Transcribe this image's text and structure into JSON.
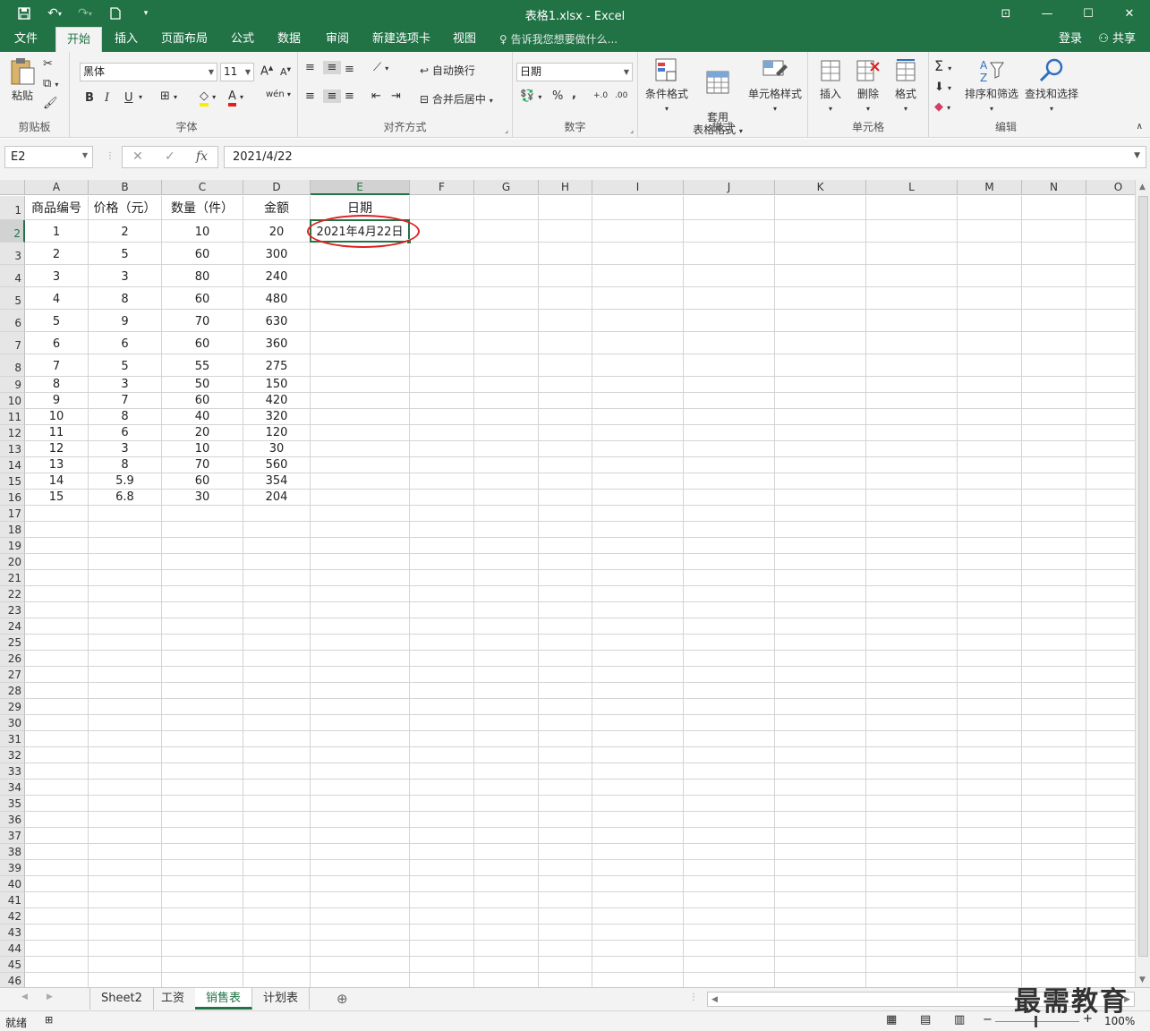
{
  "app": {
    "title": "表格1.xlsx - Excel",
    "login": "登录",
    "share": "共享",
    "tell_me": "告诉我您想要做什么..."
  },
  "tabs": [
    "文件",
    "开始",
    "插入",
    "页面布局",
    "公式",
    "数据",
    "审阅",
    "新建选项卡",
    "视图"
  ],
  "ribbon": {
    "clipboard": {
      "paste": "粘贴",
      "label": "剪贴板"
    },
    "font": {
      "name": "黑体",
      "size": "11",
      "label": "字体",
      "bold": "B",
      "italic": "I",
      "underline": "U"
    },
    "alignment": {
      "wrap": "自动换行",
      "merge": "合并后居中",
      "label": "对齐方式"
    },
    "number": {
      "format": "日期",
      "percent": "%",
      "comma": ",",
      "label": "数字"
    },
    "styles": {
      "cond": "条件格式",
      "table": "套用\n表格格式",
      "cell": "单元格样式",
      "label": "样式"
    },
    "cells": {
      "insert": "插入",
      "delete": "删除",
      "format": "格式",
      "label": "单元格"
    },
    "editing": {
      "sort": "排序和筛选",
      "find": "查找和选择",
      "label": "编辑"
    }
  },
  "formula_bar": {
    "name_box": "E2",
    "fx": "fx",
    "value": "2021/4/22"
  },
  "columns": [
    "A",
    "B",
    "C",
    "D",
    "E",
    "F",
    "G",
    "H",
    "I",
    "J",
    "K",
    "L",
    "M",
    "N",
    "O"
  ],
  "headers": [
    "商品编号",
    "价格（元）",
    "数量（件）",
    "金额",
    "日期"
  ],
  "rows": [
    [
      "1",
      "2",
      "10",
      "20",
      "2021年4月22日"
    ],
    [
      "2",
      "5",
      "60",
      "300",
      ""
    ],
    [
      "3",
      "3",
      "80",
      "240",
      ""
    ],
    [
      "4",
      "8",
      "60",
      "480",
      ""
    ],
    [
      "5",
      "9",
      "70",
      "630",
      ""
    ],
    [
      "6",
      "6",
      "60",
      "360",
      ""
    ],
    [
      "7",
      "5",
      "55",
      "275",
      ""
    ],
    [
      "8",
      "3",
      "50",
      "150",
      ""
    ],
    [
      "9",
      "7",
      "60",
      "420",
      ""
    ],
    [
      "10",
      "8",
      "40",
      "320",
      ""
    ],
    [
      "11",
      "6",
      "20",
      "120",
      ""
    ],
    [
      "12",
      "3",
      "10",
      "30",
      ""
    ],
    [
      "13",
      "8",
      "70",
      "560",
      ""
    ],
    [
      "14",
      "5.9",
      "60",
      "354",
      ""
    ],
    [
      "15",
      "6.8",
      "30",
      "204",
      ""
    ]
  ],
  "row_numbers": [
    "1",
    "2",
    "3",
    "4",
    "5",
    "6",
    "7",
    "8",
    "9",
    "10",
    "11",
    "12",
    "13",
    "14",
    "15",
    "16",
    "17",
    "18",
    "19",
    "20",
    "21",
    "22",
    "23",
    "24",
    "25",
    "26",
    "27",
    "28",
    "29",
    "30",
    "31",
    "32",
    "33",
    "34",
    "35",
    "36",
    "37",
    "38",
    "39",
    "40",
    "41",
    "42",
    "43",
    "44",
    "45",
    "46"
  ],
  "sheets": [
    "Sheet2",
    "工资",
    "销售表",
    "计划表"
  ],
  "active_sheet": "销售表",
  "status": {
    "ready": "就绪",
    "zoom": "100%"
  },
  "watermark": "最需教育",
  "colors": {
    "accent": "#217346",
    "highlight_ring": "#e02020"
  }
}
